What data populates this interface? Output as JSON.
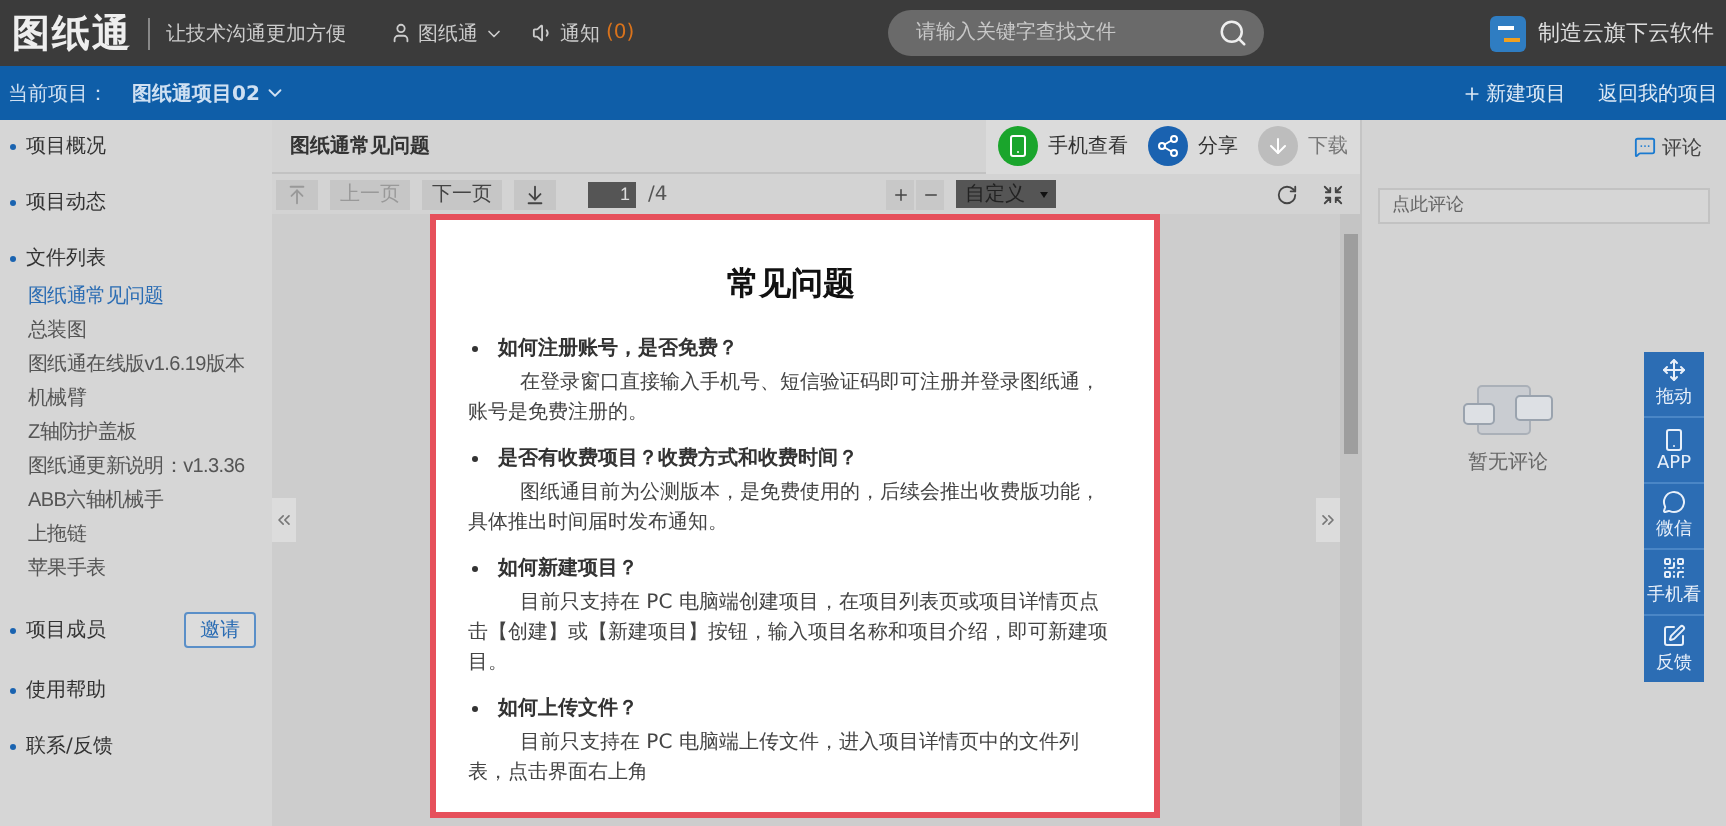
{
  "header": {
    "logo": "图纸通",
    "slogan": "让技术沟通更加方便",
    "user": "图纸通",
    "notice": "通知",
    "notice_count": "(0)",
    "search_placeholder": "请输入关键字查找文件",
    "brand": "制造云旗下云软件"
  },
  "project_bar": {
    "label": "当前项目：",
    "project": "图纸通项目02",
    "actions": [
      {
        "kind": "new",
        "label": "新建项目"
      },
      {
        "kind": "back",
        "label": "返回我的项目"
      }
    ]
  },
  "sidebar": {
    "sections": [
      {
        "label": "项目概况"
      },
      {
        "label": "项目动态"
      },
      {
        "label": "文件列表",
        "children": [
          {
            "label": "图纸通常见问题",
            "selected": true
          },
          {
            "label": "总装图",
            "selected": false
          },
          {
            "label": "图纸通在线版v1.6.19版本",
            "selected": false
          },
          {
            "label": "机械臂",
            "selected": false
          },
          {
            "label": "Z轴防护盖板",
            "selected": false
          },
          {
            "label": "图纸通更新说明：v1.3.36",
            "selected": false
          },
          {
            "label": "ABB六轴机械手",
            "selected": false
          },
          {
            "label": "上拖链",
            "selected": false
          },
          {
            "label": "苹果手表",
            "selected": false
          }
        ]
      },
      {
        "label": "项目成员",
        "button": "邀请"
      },
      {
        "label": "使用帮助"
      },
      {
        "label": "联系/反馈"
      }
    ]
  },
  "viewer": {
    "title": "图纸通常见问题",
    "actions": [
      {
        "kind": "phone",
        "label": "手机查看",
        "disabled": false
      },
      {
        "kind": "share",
        "label": "分享",
        "disabled": false
      },
      {
        "kind": "download",
        "label": "下载",
        "disabled": true
      }
    ],
    "toolbar": {
      "buttons": [
        {
          "kind": "first",
          "disabled": true
        },
        {
          "kind": "prev",
          "label": "上一页",
          "disabled": true
        },
        {
          "kind": "next",
          "label": "下一页",
          "disabled": false
        },
        {
          "kind": "last",
          "disabled": false
        }
      ],
      "page": "1",
      "total": "/4",
      "zoom": "自定义"
    },
    "document": {
      "heading": "常见问题",
      "items": [
        {
          "question": "如何注册账号，是否免费？",
          "answer": "在登录窗口直接输入手机号、短信验证码即可注册并登录图纸通，账号是免费注册的。"
        },
        {
          "question": "是否有收费项目？收费方式和收费时间？",
          "answer": "图纸通目前为公测版本，是免费使用的，后续会推出收费版功能，具体推出时间届时发布通知。"
        },
        {
          "question": "如何新建项目？",
          "answer": "目前只支持在 PC 电脑端创建项目，在项目列表页或项目详情页点击【创建】或【新建项目】按钮，输入项目名称和项目介绍，即可新建项目。"
        },
        {
          "question": "如何上传文件？",
          "answer": "目前只支持在 PC 电脑端上传文件，进入项目详情页中的文件列表，点击界面右上角"
        }
      ]
    }
  },
  "comments": {
    "title": "评论",
    "placeholder": "点此评论",
    "empty": "暂无评论"
  },
  "float_bar": [
    {
      "kind": "move",
      "label": "拖动"
    },
    {
      "kind": "app",
      "label": "APP"
    },
    {
      "kind": "wechat",
      "label": "微信"
    },
    {
      "kind": "qr",
      "label": "手机看"
    },
    {
      "kind": "feedback",
      "label": "反馈"
    }
  ]
}
